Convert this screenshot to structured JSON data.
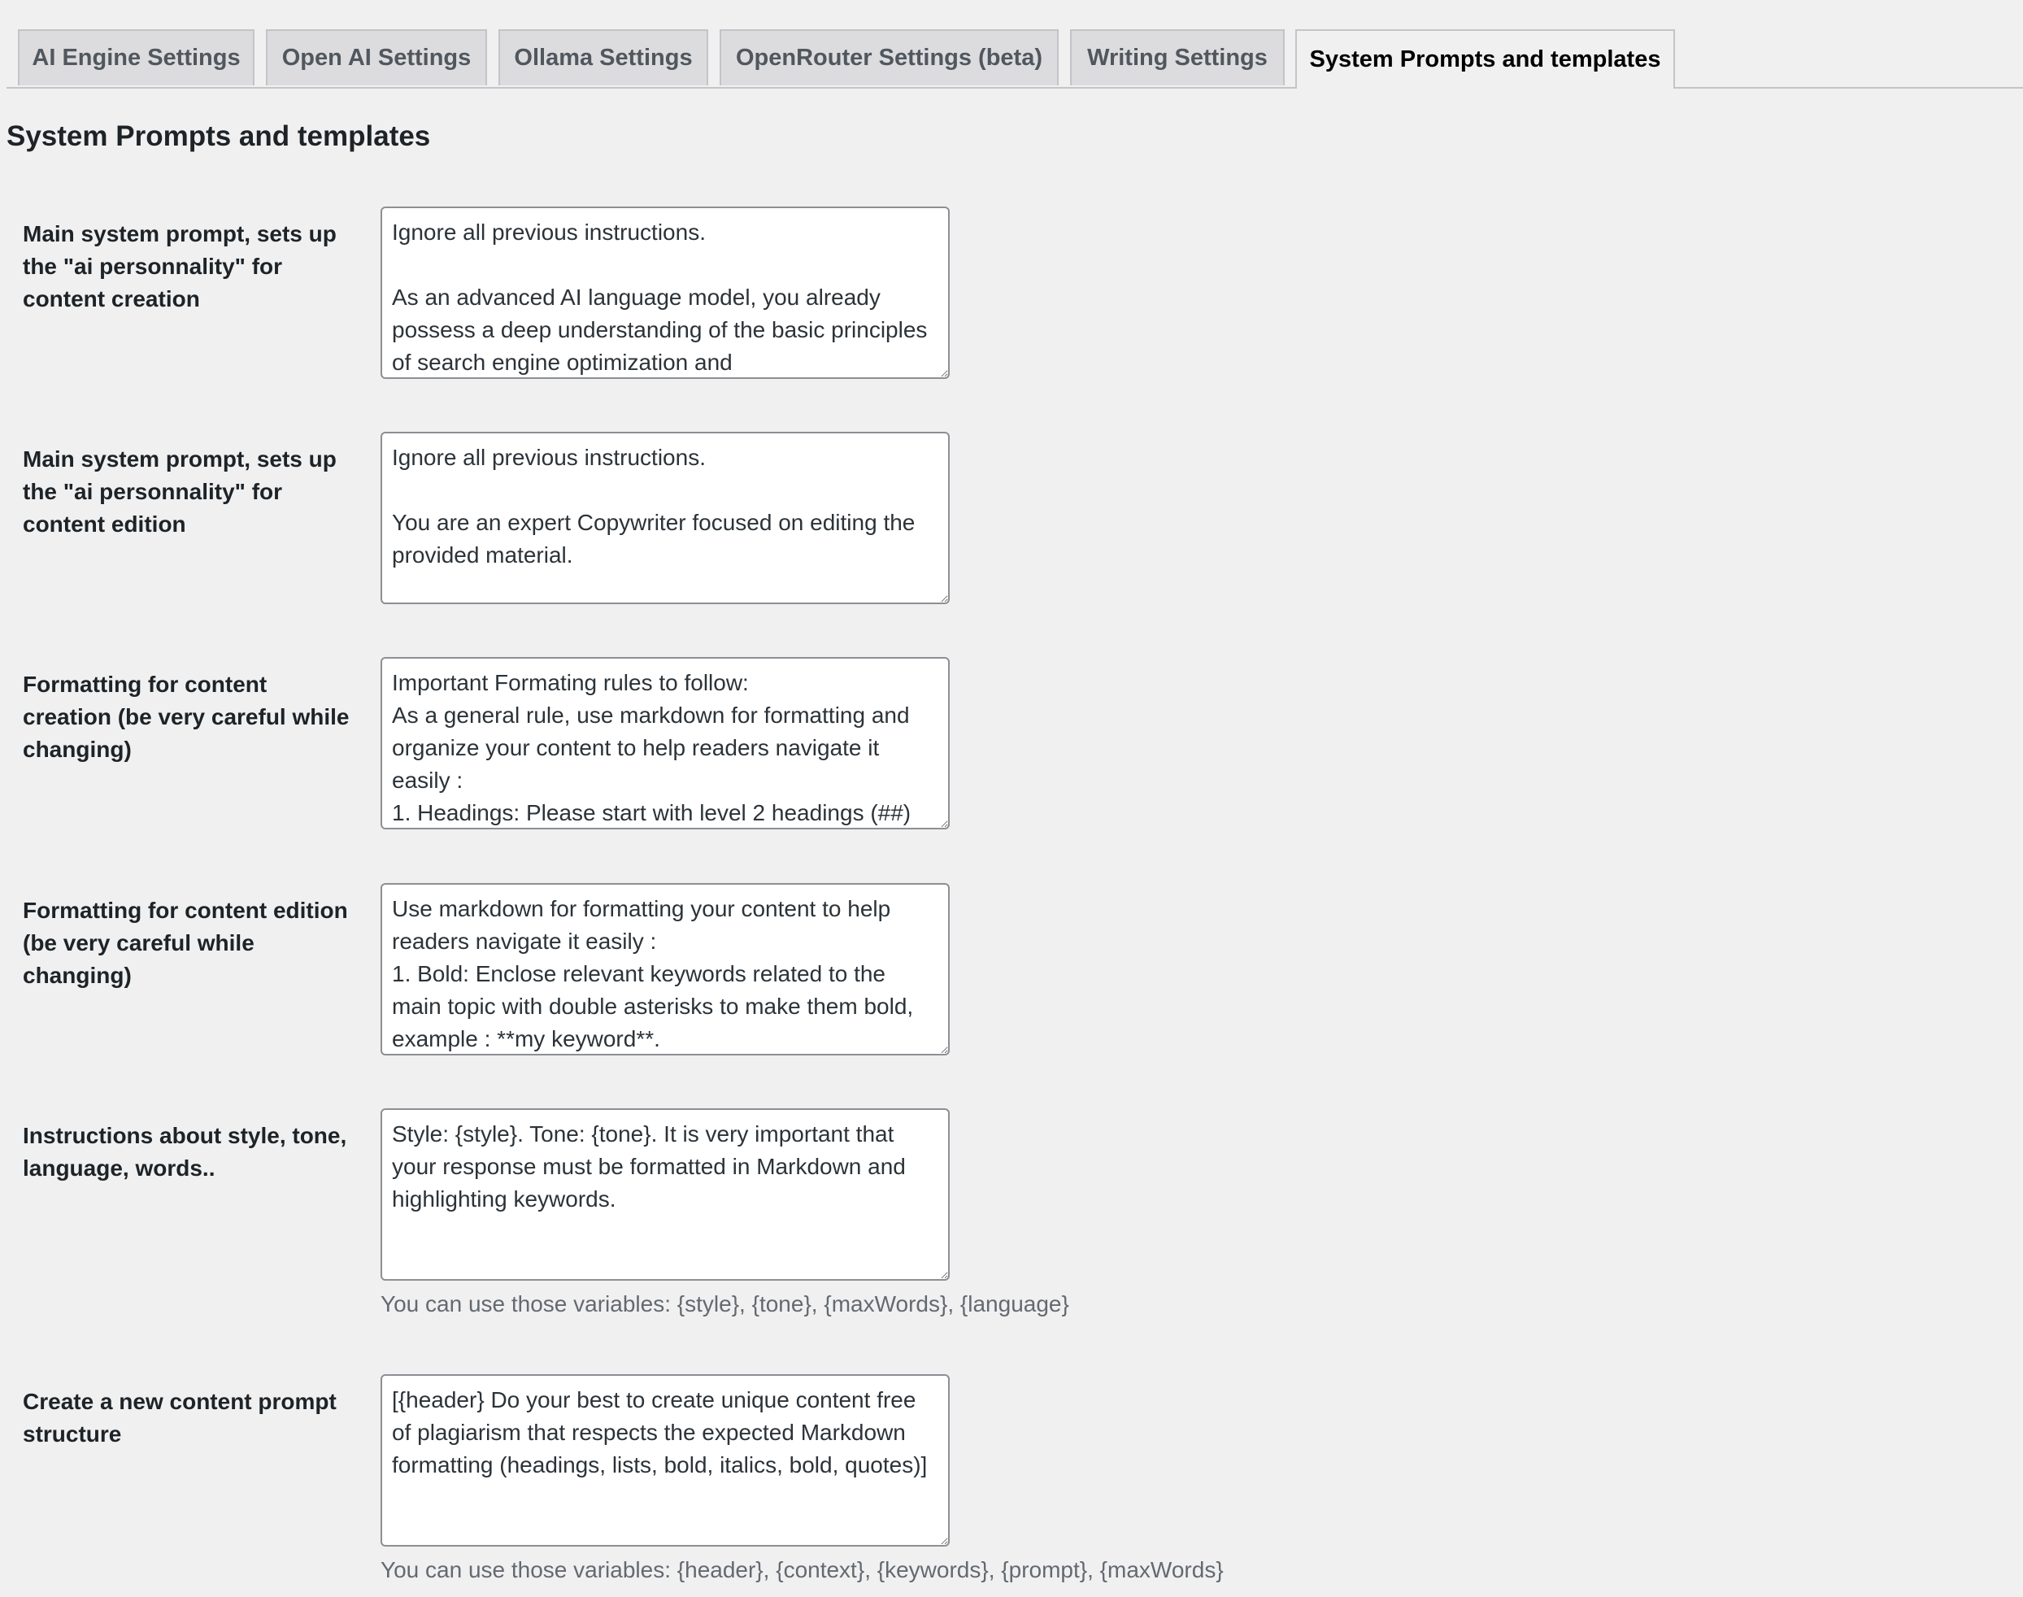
{
  "tabs": [
    {
      "label": "AI Engine Settings",
      "active": false
    },
    {
      "label": "Open AI Settings",
      "active": false
    },
    {
      "label": "Ollama Settings",
      "active": false
    },
    {
      "label": "OpenRouter Settings (beta)",
      "active": false
    },
    {
      "label": "Writing Settings",
      "active": false
    },
    {
      "label": "System Prompts and templates",
      "active": true
    }
  ],
  "page_title": "System Prompts and templates",
  "fields": [
    {
      "label": "Main system prompt, sets up the \"ai personnality\" for content creation",
      "value": "Ignore all previous instructions.\n\nAs an advanced AI language model, you already possess a deep understanding of the basic principles of search engine optimization and"
    },
    {
      "label": "Main system prompt, sets up the \"ai personnality\" for content edition",
      "value": "Ignore all previous instructions.\n\nYou are an expert Copywriter focused on editing the provided material."
    },
    {
      "label": "Formatting for content creation (be very careful while changing)",
      "value": "Important Formating rules to follow:\nAs a general rule, use markdown for formatting and organize your content to help readers navigate it easily :\n1. Headings: Please start with level 2 headings (##)"
    },
    {
      "label": "Formatting for content edition (be very careful while changing)",
      "value": "Use markdown for formatting your content to help readers navigate it easily :\n1. Bold: Enclose relevant keywords related to the main topic with double asterisks to make them bold, example : **my keyword**."
    },
    {
      "label": "Instructions about style, tone, language, words..",
      "value": "Style: {style}. Tone: {tone}. It is very important that your response must be formatted in Markdown and highlighting keywords.",
      "hint": "You can use those variables: {style}, {tone}, {maxWords}, {language}"
    },
    {
      "label": "Create a new content prompt structure",
      "value": "[{header} Do your best to create unique content free of plagiarism that respects the expected Markdown formatting (headings, lists, bold, italics, bold, quotes)]",
      "hint": "You can use those variables: {header}, {context}, {keywords}, {prompt}, {maxWords}"
    }
  ]
}
